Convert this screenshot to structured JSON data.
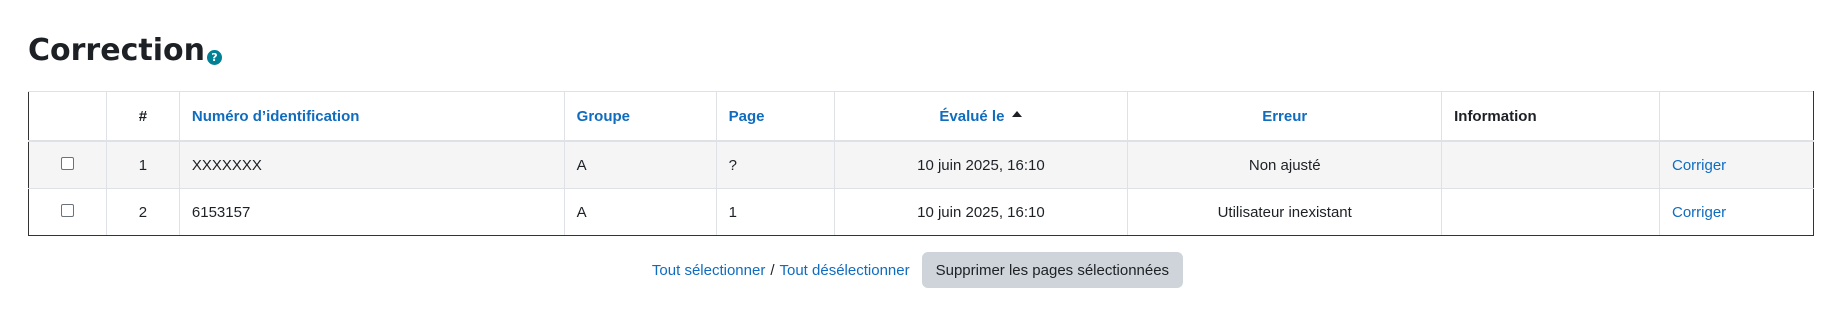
{
  "page": {
    "title": "Correction",
    "help_icon": "question-circle-icon"
  },
  "table": {
    "headers": {
      "select": "",
      "number": "#",
      "id": "Numéro d’identification",
      "group": "Groupe",
      "page": "Page",
      "evaluated": "Évalué le",
      "error": "Erreur",
      "info": "Information",
      "action": ""
    },
    "sorted_column": "evaluated",
    "sort_direction": "ascending",
    "rows": [
      {
        "number": "1",
        "id": "XXXXXXX",
        "group": "A",
        "page": "?",
        "evaluated": "10 juin 2025, 16:10",
        "error": "Non ajusté",
        "info": "",
        "action": "Corriger"
      },
      {
        "number": "2",
        "id": "6153157",
        "group": "A",
        "page": "1",
        "evaluated": "10 juin 2025, 16:10",
        "error": "Utilisateur inexistant",
        "info": "",
        "action": "Corriger"
      }
    ]
  },
  "footer": {
    "select_all": "Tout sélectionner",
    "separator": "/",
    "deselect_all": "Tout désélectionner",
    "delete_button": "Supprimer les pages sélectionnées"
  },
  "colors": {
    "link": "#0f6cbf",
    "help_icon": "#008196",
    "button_bg": "#ced4da",
    "striped_row": "#f5f5f5"
  }
}
